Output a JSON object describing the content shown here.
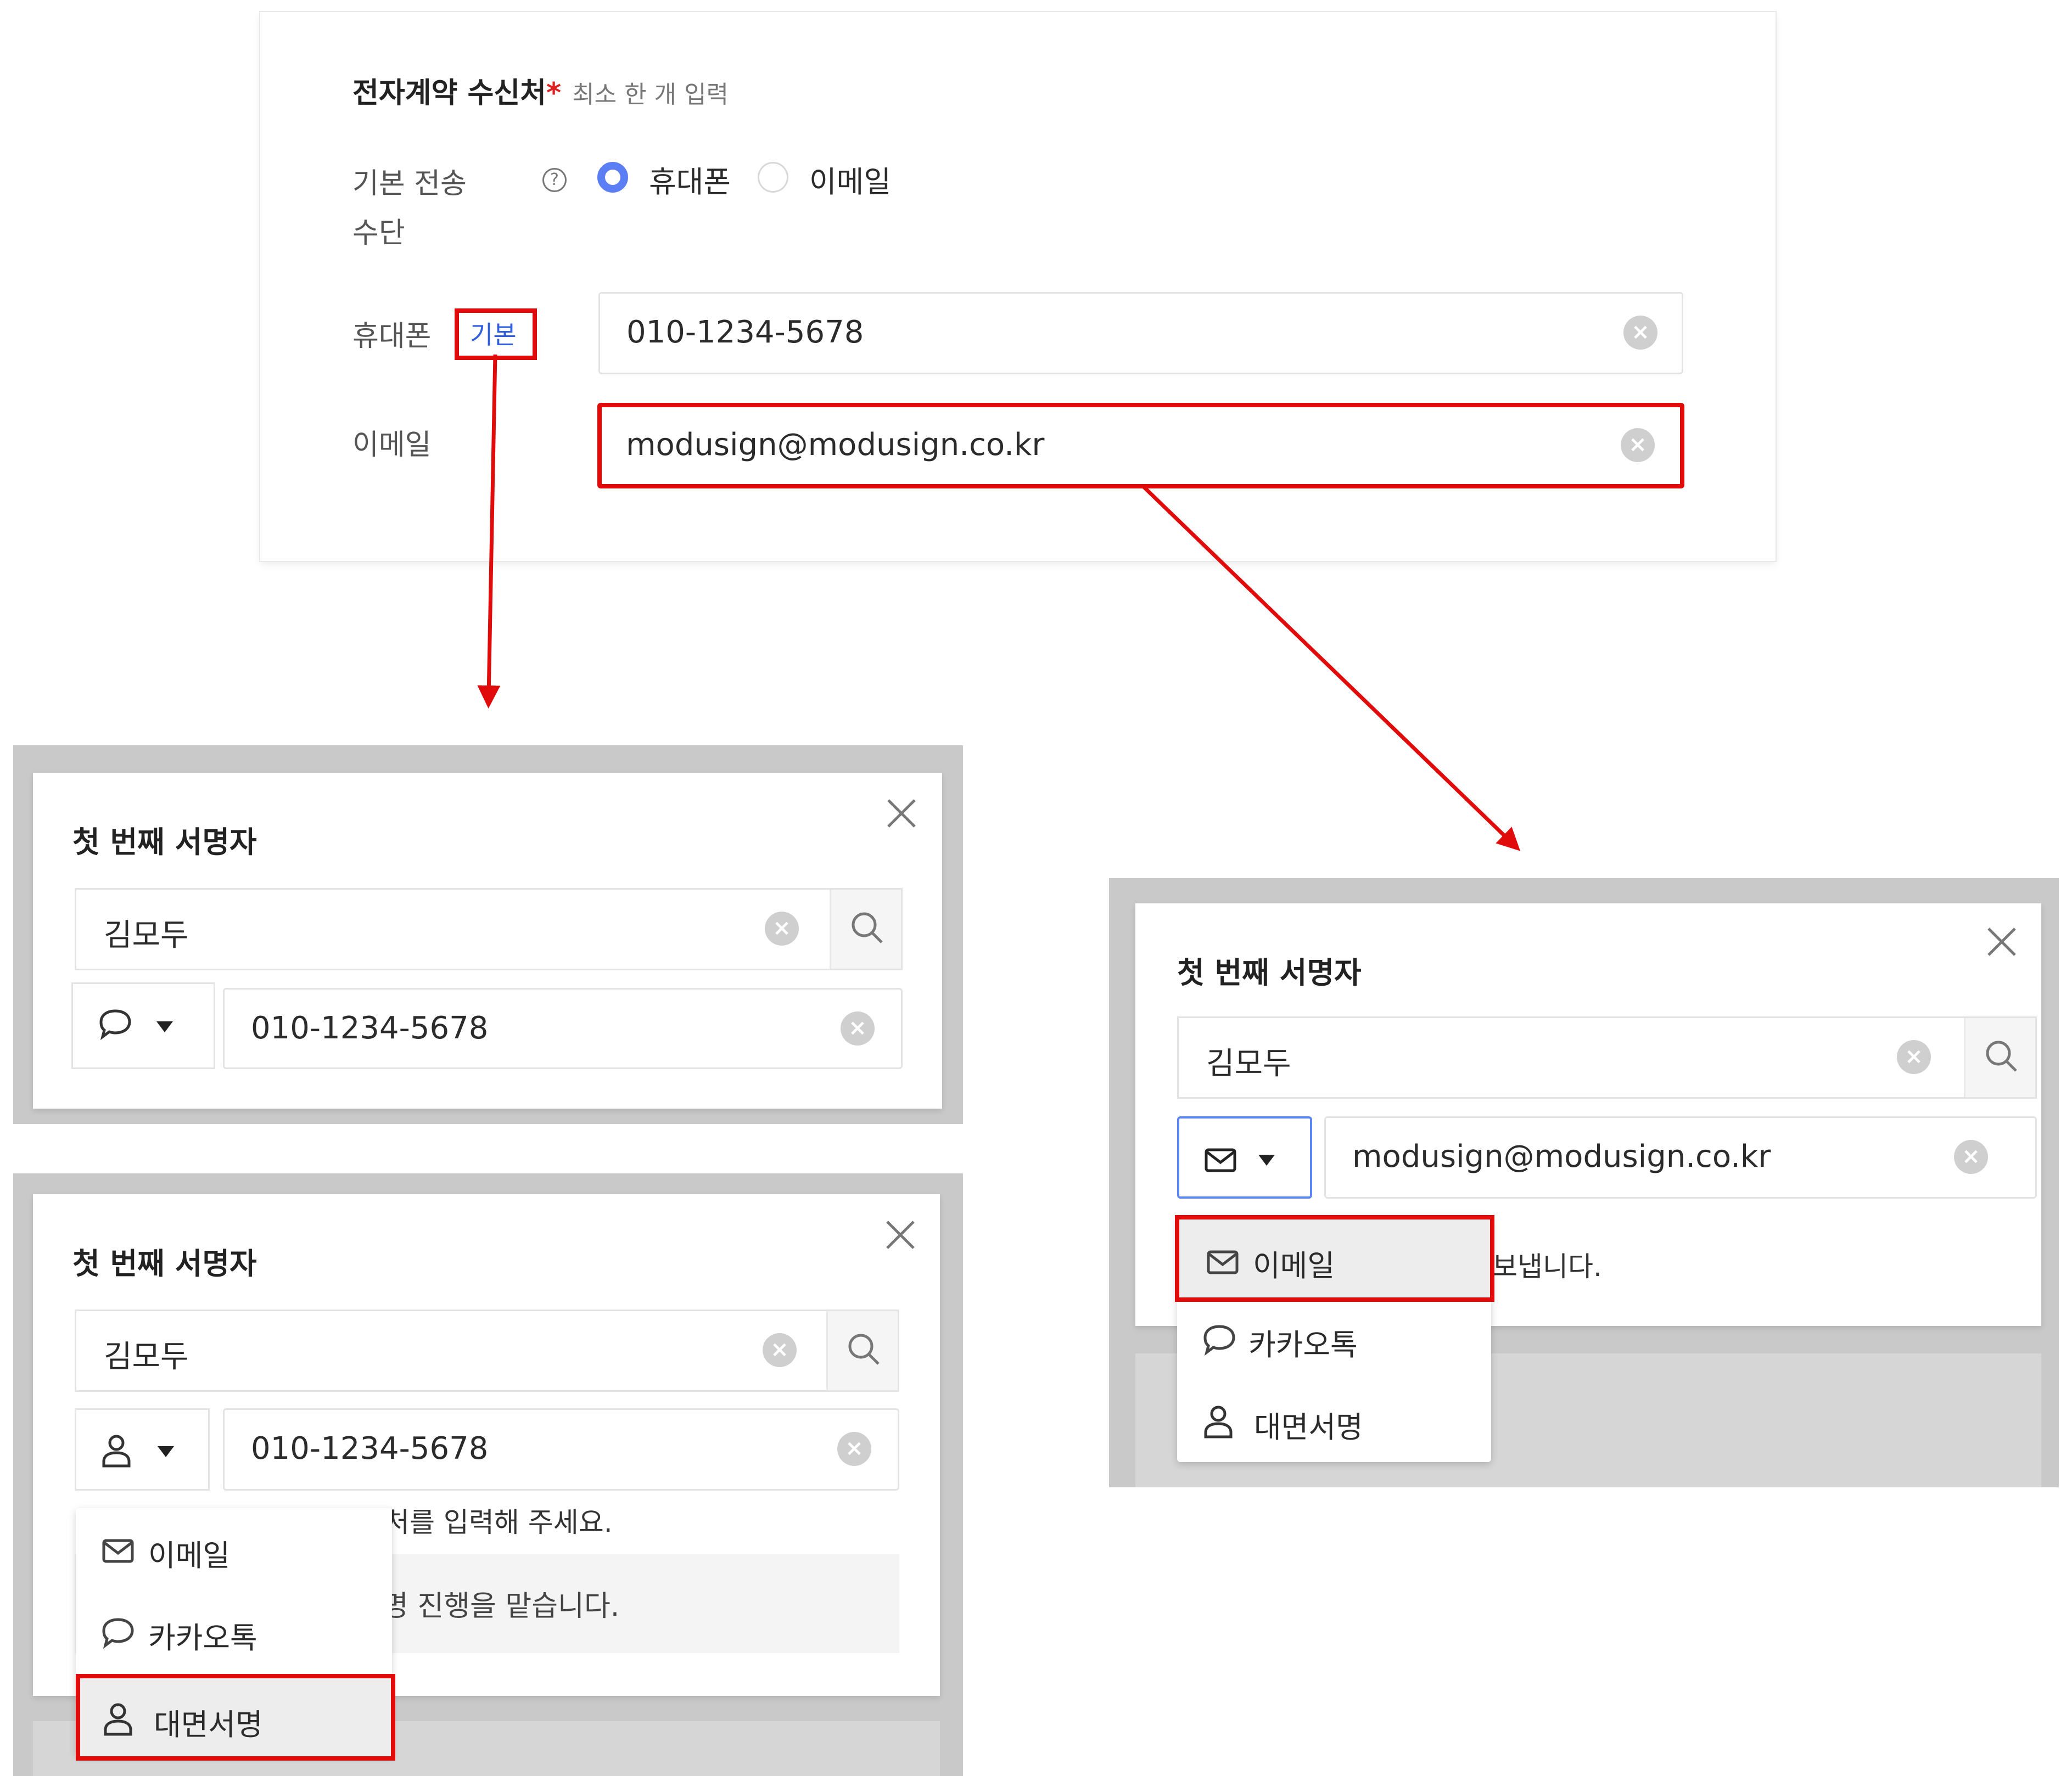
{
  "top": {
    "title": "전자계약 수신처",
    "required_mark": "*",
    "subtitle": "최소 한 개 입력",
    "default_method_label": "기본 전송",
    "default_method_label_2": "수단",
    "help_glyph": "?",
    "radio_phone": "휴대폰",
    "radio_email": "이메일",
    "selected": "휴대폰",
    "phone_label": "휴대폰",
    "phone_badge": "기본",
    "phone_value": "010-1234-5678",
    "email_label": "이메일",
    "email_value": "modusign@modusign.co.kr"
  },
  "dialog_kakao": {
    "title": "첫 번째 서명자",
    "name_value": "김모두",
    "method_icon": "chat-icon",
    "contact_value": "010-1234-5678"
  },
  "dialog_inperson": {
    "title": "첫 번째 서명자",
    "name_value": "김모두",
    "method_icon": "person-icon",
    "contact_value": "010-1234-5678",
    "hint_partial": "처를 입력해 주세요.",
    "info_partial": "명 진행을 맡습니다.",
    "menu": [
      {
        "icon": "mail-icon",
        "label": "이메일"
      },
      {
        "icon": "chat-icon",
        "label": "카카오톡"
      },
      {
        "icon": "person-icon",
        "label": "대면서명"
      }
    ],
    "selected_item": "대면서명"
  },
  "dialog_email": {
    "title": "첫 번째 서명자",
    "name_value": "김모두",
    "method_icon": "mail-icon",
    "contact_value": "modusign@modusign.co.kr",
    "hint_partial": "보냅니다.",
    "menu": [
      {
        "icon": "mail-icon",
        "label": "이메일"
      },
      {
        "icon": "chat-icon",
        "label": "카카오톡"
      },
      {
        "icon": "person-icon",
        "label": "대면서명"
      }
    ],
    "selected_item": "이메일"
  },
  "colors": {
    "highlight_red": "#e00b0b",
    "accent_blue": "#5b7ef5",
    "badge_blue": "#2f5fdc"
  }
}
